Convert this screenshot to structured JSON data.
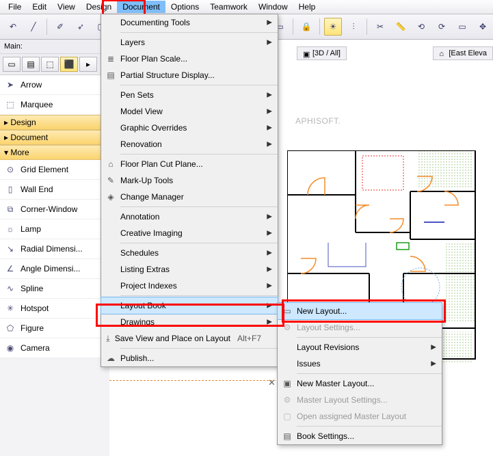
{
  "menubar": {
    "items": [
      "File",
      "Edit",
      "View",
      "Design",
      "Document",
      "Options",
      "Teamwork",
      "Window",
      "Help"
    ],
    "active": "Document"
  },
  "info_strip": {
    "label": "Main:"
  },
  "view_tabs": {
    "tab3d": "[3D / All]",
    "elev": "[East Eleva"
  },
  "canvas": {
    "watermark": "APHISOFT."
  },
  "left_tools": {
    "arrow_item": "Arrow",
    "marquee_item": "Marquee",
    "headers": [
      "Design",
      "Document",
      "More"
    ],
    "items": [
      {
        "icon": "⊙",
        "label": "Grid Element"
      },
      {
        "icon": "▯",
        "label": "Wall End"
      },
      {
        "icon": "⧉",
        "label": "Corner-Window"
      },
      {
        "icon": "☼",
        "label": "Lamp"
      },
      {
        "icon": "↘",
        "label": "Radial Dimensi..."
      },
      {
        "icon": "∠",
        "label": "Angle Dimensi..."
      },
      {
        "icon": "∿",
        "label": "Spline"
      },
      {
        "icon": "✳",
        "label": "Hotspot"
      },
      {
        "icon": "⬠",
        "label": "Figure"
      },
      {
        "icon": "◉",
        "label": "Camera"
      }
    ]
  },
  "document_menu": [
    {
      "icon": "",
      "label": "Documenting Tools",
      "sub": true
    },
    {
      "sep": true
    },
    {
      "icon": "",
      "label": "Layers",
      "sub": true
    },
    {
      "icon": "≣",
      "label": "Floor Plan Scale..."
    },
    {
      "icon": "▤",
      "label": "Partial Structure Display..."
    },
    {
      "sep": true
    },
    {
      "icon": "",
      "label": "Pen Sets",
      "sub": true
    },
    {
      "icon": "",
      "label": "Model View",
      "sub": true
    },
    {
      "icon": "",
      "label": "Graphic Overrides",
      "sub": true
    },
    {
      "icon": "",
      "label": "Renovation",
      "sub": true
    },
    {
      "sep": true
    },
    {
      "icon": "⌂",
      "label": "Floor Plan Cut Plane..."
    },
    {
      "icon": "✎",
      "label": "Mark-Up Tools"
    },
    {
      "icon": "◈",
      "label": "Change Manager"
    },
    {
      "sep": true
    },
    {
      "icon": "",
      "label": "Annotation",
      "sub": true
    },
    {
      "icon": "",
      "label": "Creative Imaging",
      "sub": true
    },
    {
      "sep": true
    },
    {
      "icon": "",
      "label": "Schedules",
      "sub": true
    },
    {
      "icon": "",
      "label": "Listing Extras",
      "sub": true
    },
    {
      "icon": "",
      "label": "Project Indexes",
      "sub": true
    },
    {
      "sep": true
    },
    {
      "icon": "",
      "label": "Layout Book",
      "sub": true,
      "hl": true
    },
    {
      "icon": "",
      "label": "Drawings",
      "sub": true
    },
    {
      "icon": "⤓",
      "label": "Save View and Place on Layout",
      "shortcut": "Alt+F7"
    },
    {
      "sep": true
    },
    {
      "icon": "☁",
      "label": "Publish..."
    }
  ],
  "layout_submenu": [
    {
      "icon": "▭",
      "label": "New Layout...",
      "hl": true
    },
    {
      "icon": "⚙",
      "label": "Layout Settings...",
      "disabled": true
    },
    {
      "sep": true
    },
    {
      "icon": "",
      "label": "Layout Revisions",
      "sub": true
    },
    {
      "icon": "",
      "label": "Issues",
      "sub": true
    },
    {
      "sep": true
    },
    {
      "icon": "▣",
      "label": "New Master Layout..."
    },
    {
      "icon": "⚙",
      "label": "Master Layout Settings...",
      "disabled": true
    },
    {
      "icon": "▢",
      "label": "Open assigned Master Layout",
      "disabled": true
    },
    {
      "sep": true
    },
    {
      "icon": "▤",
      "label": "Book Settings..."
    }
  ]
}
